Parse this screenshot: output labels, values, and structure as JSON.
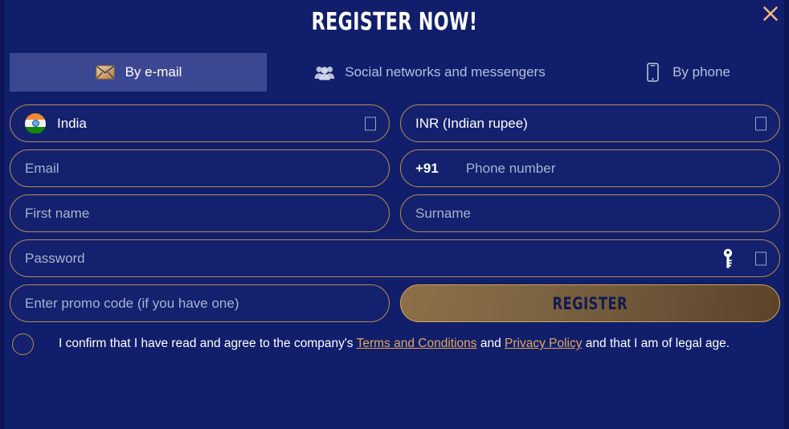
{
  "header": {
    "title": "REGISTER NOW!",
    "close_icon": "close-icon"
  },
  "tabs": [
    {
      "id": "by-email",
      "label": "By e-mail",
      "icon": "envelope-icon",
      "active": true
    },
    {
      "id": "by-social",
      "label": "Social networks and messengers",
      "icon": "people-group-icon",
      "active": false
    },
    {
      "id": "by-phone",
      "label": "By phone",
      "icon": "smartphone-icon",
      "active": false
    }
  ],
  "form": {
    "country": {
      "label": "India",
      "flag_icon": "india-flag-icon",
      "dropdown_icon": "chevron-down-icon"
    },
    "currency": {
      "label": "INR (Indian rupee)",
      "dropdown_icon": "chevron-down-icon"
    },
    "email": {
      "placeholder": "Email",
      "value": ""
    },
    "phone": {
      "dial_code": "+91",
      "placeholder": "Phone number",
      "value": ""
    },
    "first_name": {
      "placeholder": "First name",
      "value": ""
    },
    "surname": {
      "placeholder": "Surname",
      "value": ""
    },
    "password": {
      "placeholder": "Password",
      "value": "",
      "key_icon": "key-icon",
      "reveal_icon": "eye-icon"
    },
    "promo": {
      "placeholder": "Enter promo code (if you have one)",
      "value": ""
    },
    "register_label": "REGISTER"
  },
  "consent": {
    "checked": false,
    "text_before": "I confirm that I have read and agree to the company's ",
    "link_terms": "Terms and Conditions",
    "text_middle": " and ",
    "link_privacy": "Privacy Policy",
    "text_after": " and that I am of legal age."
  },
  "colors": {
    "background": "#111e6c",
    "field_border": "#b98a52",
    "accent_gold": "#e2a75a",
    "tab_active_bg": "#3b4793",
    "placeholder": "#aab2cc",
    "register_text": "#101b4f"
  }
}
